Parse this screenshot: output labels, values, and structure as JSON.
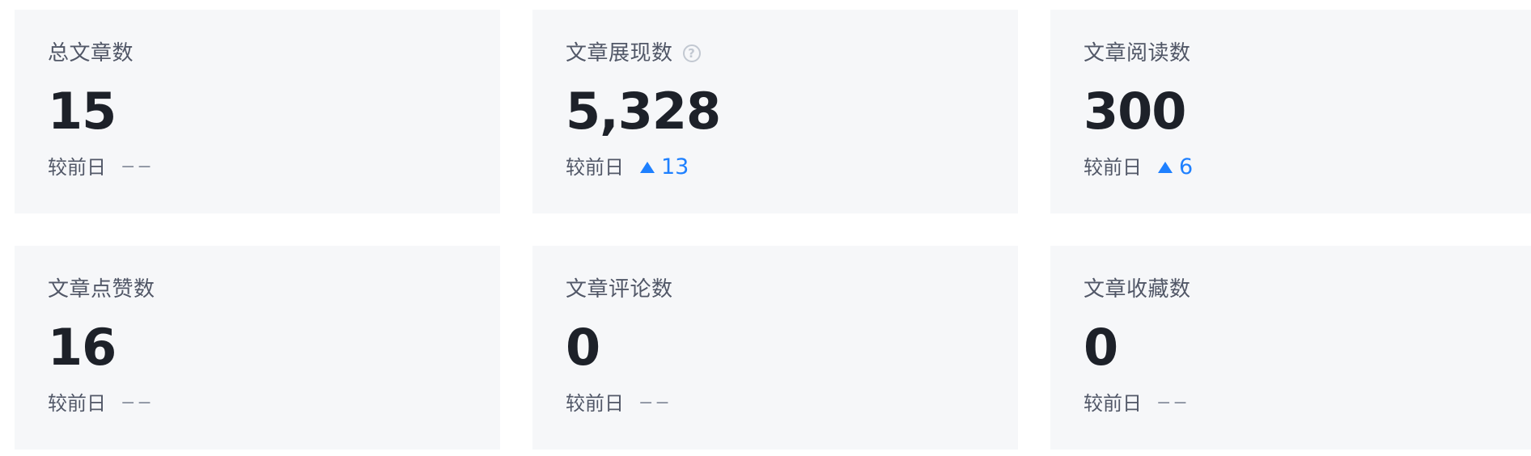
{
  "compare_label": "较前日",
  "no_change": "−−",
  "accent_color": "#1e80ff",
  "cards": [
    {
      "label": "总文章数",
      "value": "15",
      "delta": null
    },
    {
      "label": "文章展现数",
      "value": "5,328",
      "delta": "13",
      "help_icon": "question-circle-icon"
    },
    {
      "label": "文章阅读数",
      "value": "300",
      "delta": "6"
    },
    {
      "label": "文章点赞数",
      "value": "16",
      "delta": null
    },
    {
      "label": "文章评论数",
      "value": "0",
      "delta": null
    },
    {
      "label": "文章收藏数",
      "value": "0",
      "delta": null
    }
  ]
}
